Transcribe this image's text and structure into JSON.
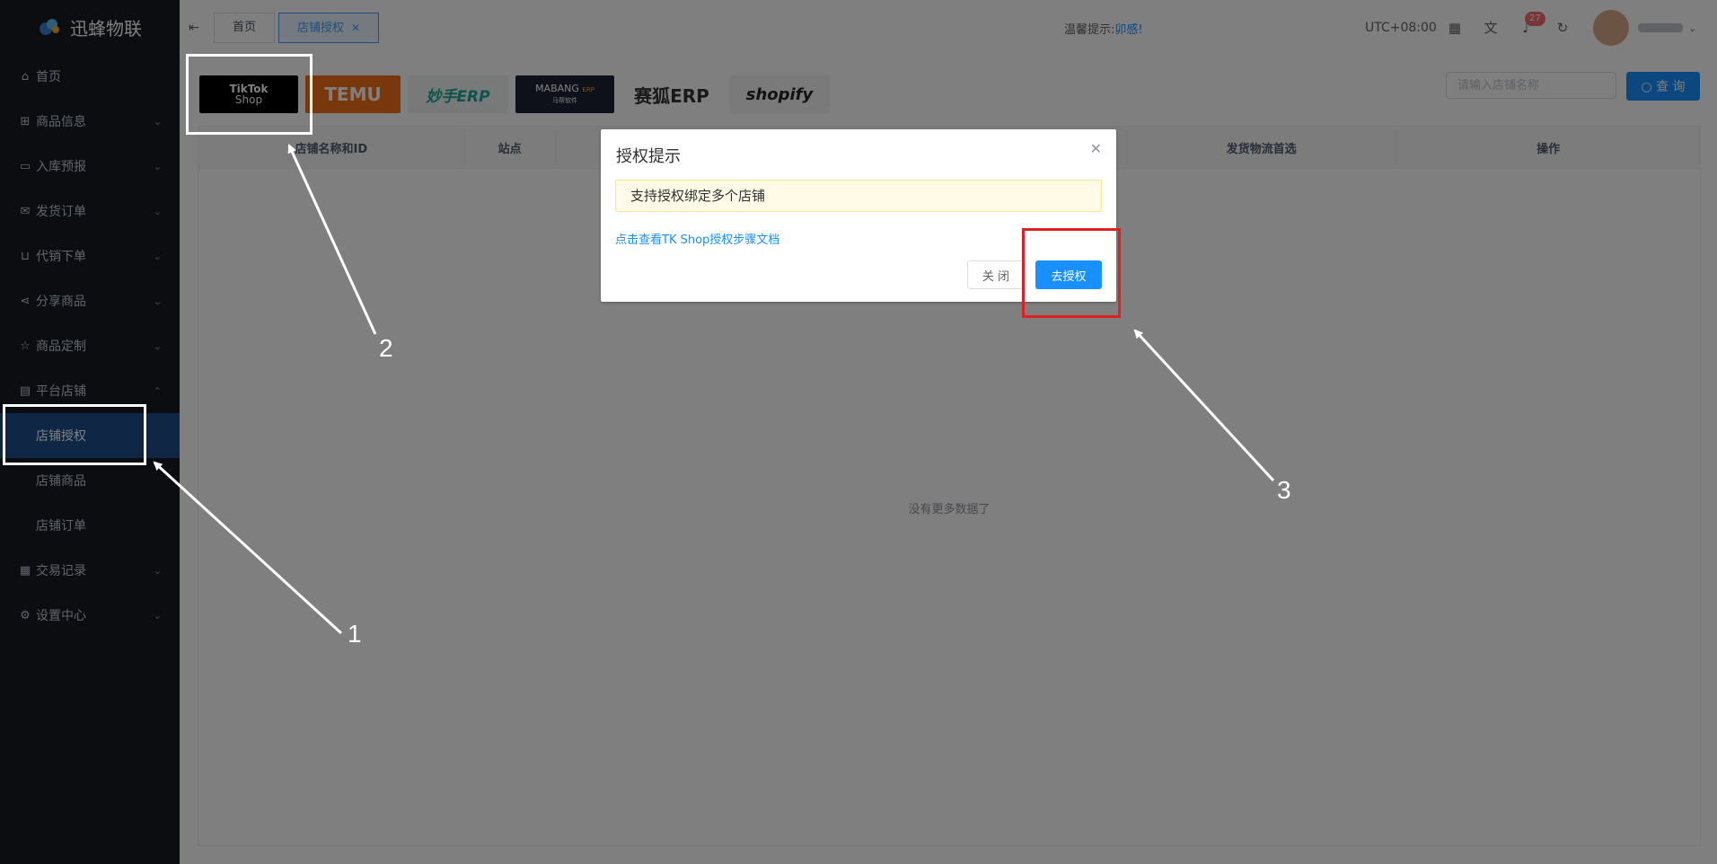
{
  "app": {
    "name": "迅蜂物联"
  },
  "sidebar": {
    "items": [
      {
        "label": "首页",
        "icon": "home-icon"
      },
      {
        "label": "商品信息",
        "icon": "gift-icon"
      },
      {
        "label": "入库预报",
        "icon": "inbox-icon"
      },
      {
        "label": "发货订单",
        "icon": "mail-icon"
      },
      {
        "label": "代销下单",
        "icon": "cart-icon"
      },
      {
        "label": "分享商品",
        "icon": "share-icon"
      },
      {
        "label": "商品定制",
        "icon": "pin-icon"
      },
      {
        "label": "平台店铺",
        "icon": "shop-icon"
      },
      {
        "label": "交易记录",
        "icon": "document-icon"
      },
      {
        "label": "设置中心",
        "icon": "gear-icon"
      }
    ],
    "sub_items": [
      "店铺授权",
      "店铺商品",
      "店铺订单"
    ]
  },
  "header": {
    "tabs": [
      {
        "label": "首页"
      },
      {
        "label": "店铺授权"
      }
    ],
    "tip_label": "温馨提示:",
    "tip_text": "卯感!",
    "timezone": "UTC+08:00",
    "notification_count": "27"
  },
  "platforms": [
    "TikTok",
    "Shop",
    "TEMU",
    "妙手ERP",
    "MABANG",
    "ERP",
    "马帮软件",
    "赛狐ERP",
    "shopify"
  ],
  "search": {
    "placeholder": "请输入店铺名称",
    "button_label": "查 询"
  },
  "table": {
    "columns": [
      "店铺名称和ID",
      "站点",
      "发货物流首选",
      "操作"
    ],
    "empty_text": "没有更多数据了"
  },
  "dialog": {
    "title": "授权提示",
    "alert": "支持授权绑定多个店铺",
    "doc_link": "点击查看TK Shop授权步骤文档",
    "close_label": "关 闭",
    "confirm_label": "去授权"
  },
  "annotations": [
    "1",
    "2",
    "3"
  ],
  "colors": {
    "sidebar_bg": "#191a23",
    "active_menu": "#1f4e8b",
    "primary": "#1890ff",
    "highlight_box": "#e02020"
  }
}
